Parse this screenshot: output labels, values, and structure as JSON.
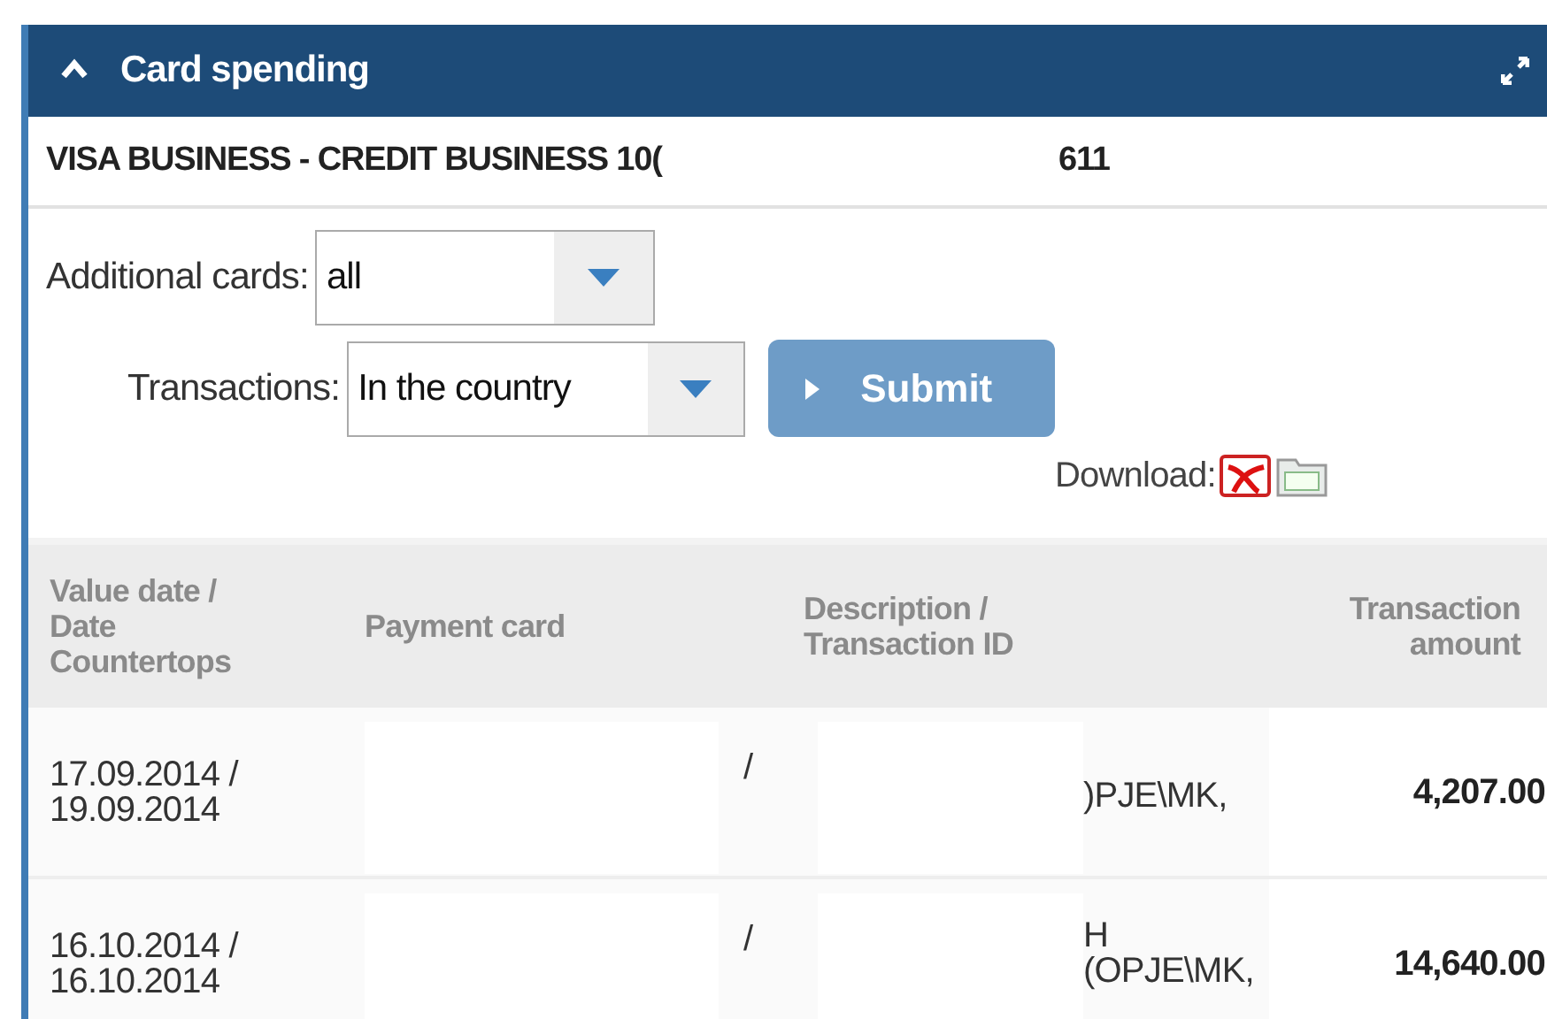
{
  "panel": {
    "title": "Card spending",
    "expanded": true
  },
  "card": {
    "name": "VISA BUSINESS - CREDIT BUSINESS 10(",
    "suffix": "611"
  },
  "filters": [
    {
      "label": "Additional cards:",
      "value": "all"
    },
    {
      "label": "Transactions:",
      "value": "In the country"
    }
  ],
  "submit": "Submit",
  "download": {
    "label": "Download:"
  },
  "table": {
    "columns": [
      "Value date / Date Countertops",
      "Payment card",
      "Description / Transaction ID",
      "Transaction amount"
    ],
    "rows": [
      {
        "date": "17.09.2014 / 19.09.2014",
        "card": "/",
        "description": [
          ")PJE\\MK,"
        ],
        "amount": "4,207.00"
      },
      {
        "date": "16.10.2014 / 16.10.2014",
        "card": "/",
        "description": [
          "H",
          "(OPJE\\MK,"
        ],
        "amount": "14,640.00"
      }
    ]
  }
}
